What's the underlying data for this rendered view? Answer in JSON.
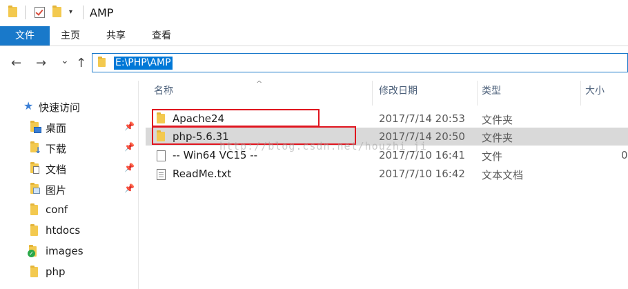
{
  "window": {
    "title": "AMP",
    "quick_access_toolbar": [
      "folder-icon",
      "properties-check-icon",
      "new-folder-icon",
      "customize-dropdown-icon"
    ]
  },
  "ribbon": {
    "tabs": [
      {
        "label": "文件",
        "active": true
      },
      {
        "label": "主页"
      },
      {
        "label": "共享"
      },
      {
        "label": "查看"
      }
    ],
    "accent": "#1979ca"
  },
  "nav": {
    "back": "←",
    "forward": "→",
    "recent": "⌄",
    "up": "↑",
    "address": "E:\\PHP\\AMP"
  },
  "sidebar": {
    "quick_access": "快速访问",
    "items": [
      {
        "label": "桌面",
        "icon": "desktop-icon",
        "pinned": true
      },
      {
        "label": "下载",
        "icon": "downloads-icon",
        "pinned": true
      },
      {
        "label": "文档",
        "icon": "documents-icon",
        "pinned": true
      },
      {
        "label": "图片",
        "icon": "pictures-icon",
        "pinned": true
      },
      {
        "label": "conf",
        "icon": "folder-icon",
        "pinned": false
      },
      {
        "label": "htdocs",
        "icon": "folder-icon",
        "pinned": false
      },
      {
        "label": "images",
        "icon": "folder-synced-icon",
        "pinned": false
      },
      {
        "label": "php",
        "icon": "folder-icon",
        "pinned": false
      }
    ]
  },
  "columns": {
    "name": "名称",
    "modified": "修改日期",
    "type": "类型",
    "size": "大小"
  },
  "files": [
    {
      "name": "Apache24",
      "modified": "2017/7/14 20:53",
      "type": "文件夹",
      "size": "",
      "icon": "folder-icon",
      "highlighted": true
    },
    {
      "name": "php-5.6.31",
      "modified": "2017/7/14 20:50",
      "type": "文件夹",
      "size": "",
      "icon": "folder-icon",
      "highlighted": true,
      "selected": true
    },
    {
      "name": "-- Win64 VC15 --",
      "modified": "2017/7/10 16:41",
      "type": "文件",
      "size": "0",
      "icon": "file-icon"
    },
    {
      "name": "ReadMe.txt",
      "modified": "2017/7/10 16:42",
      "type": "文本文档",
      "size": "",
      "icon": "text-file-icon"
    }
  ],
  "watermark": "http://blog.csdn.net/houzhi_ji"
}
